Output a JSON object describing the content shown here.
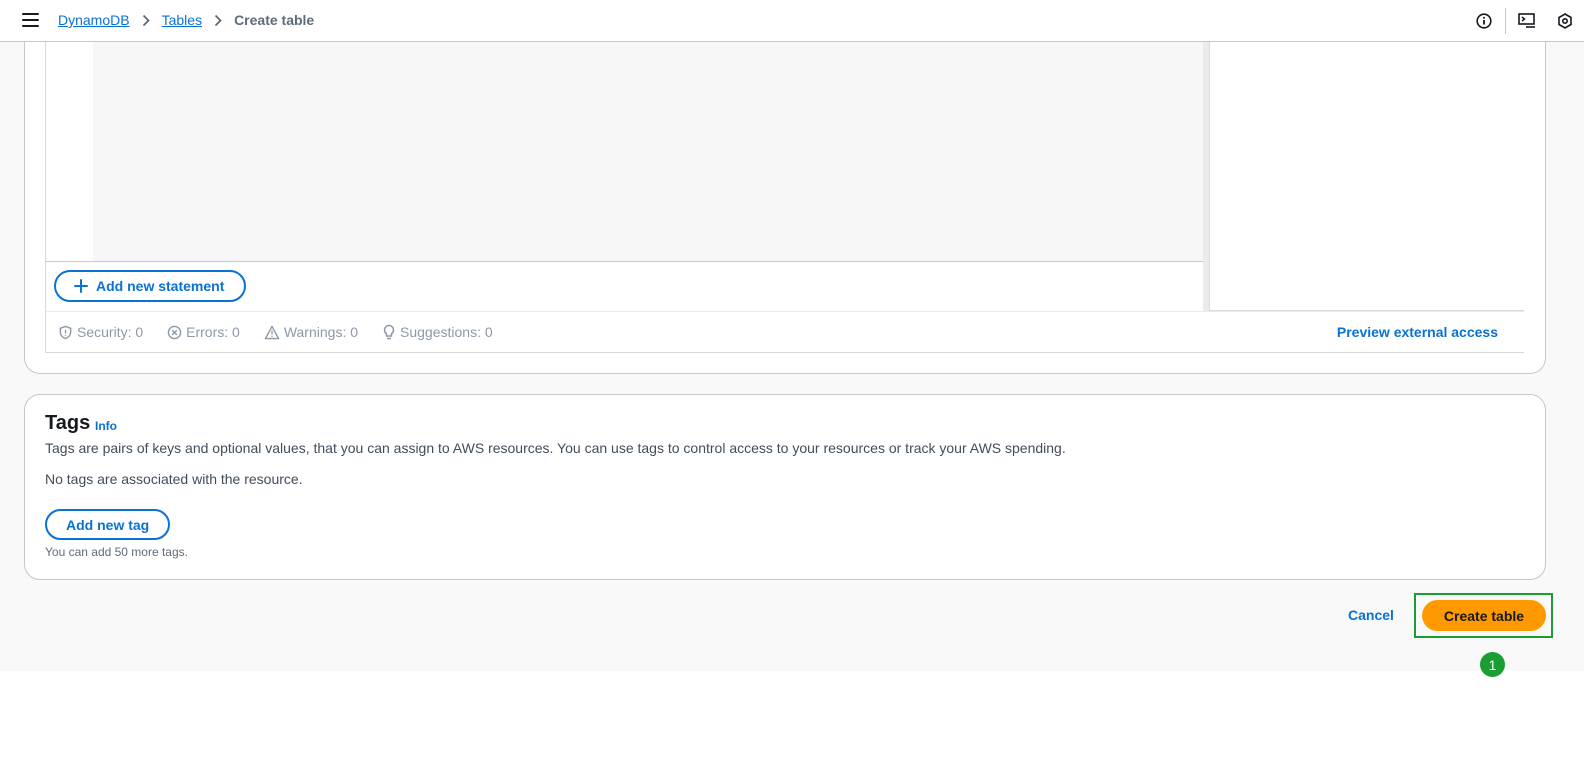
{
  "breadcrumb": {
    "items": [
      {
        "label": "DynamoDB",
        "link": true
      },
      {
        "label": "Tables",
        "link": true
      },
      {
        "label": "Create table",
        "link": false
      }
    ]
  },
  "top_icons": [
    "info-icon",
    "cloudshell-icon",
    "settings-icon"
  ],
  "policy_editor": {
    "add_statement_label": "Add new statement",
    "status": {
      "security": "Security: 0",
      "errors": "Errors: 0",
      "warnings": "Warnings: 0",
      "suggestions": "Suggestions: 0"
    },
    "preview_label": "Preview external access"
  },
  "tags": {
    "title": "Tags",
    "info": "Info",
    "description": "Tags are pairs of keys and optional values, that you can assign to AWS resources. You can use tags to control access to your resources or track your AWS spending.",
    "empty_message": "No tags are associated with the resource.",
    "add_label": "Add new tag",
    "hint": "You can add 50 more tags."
  },
  "actions": {
    "cancel_label": "Cancel",
    "create_label": "Create table"
  },
  "annotation": {
    "marker": "1"
  },
  "colors": {
    "link": "#0972d3",
    "primary_button": "#ff9900",
    "highlight": "#1a9e33"
  }
}
